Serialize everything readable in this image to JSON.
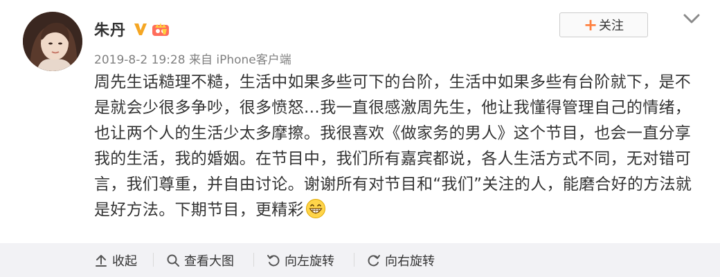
{
  "post": {
    "author": {
      "name": "朱丹",
      "verified_icon": "verified-v-icon",
      "member_icon": "crown-member-icon"
    },
    "meta": {
      "timestamp": "2019-8-2 19:28",
      "source": "来自 iPhone客户端"
    },
    "follow_button": {
      "plus": "+",
      "label": "关注"
    },
    "menu_icon": "chevron-down-icon",
    "content": {
      "text": "周先生话糙理不糙，生活中如果多些可下的台阶，生活中如果多些有台阶就下，是不是就会少很多争吵，很多愤怒…我一直很感激周先生，他让我懂得管理自己的情绪，也让两个人的生活少太多摩擦。我很喜欢《做家务的男人》这个节目，也会一直分享我的生活，我的婚姻。在节目中，我们所有嘉宾都说，各人生活方式不同，无对错可言，我们尊重，并自由讨论。谢谢所有对节目和“我们”关注的人，能磨合好的方法就是好方法。下期节目，更精彩",
      "emoji": "grin-emoji"
    }
  },
  "toolbar": {
    "collapse": {
      "label": "收起",
      "icon": "collapse-arrow-icon"
    },
    "view_large": {
      "label": "查看大图",
      "icon": "search-icon"
    },
    "rotate_left": {
      "label": "向左旋转",
      "icon": "rotate-left-icon"
    },
    "rotate_right": {
      "label": "向右旋转",
      "icon": "rotate-right-icon"
    }
  },
  "colors": {
    "accent_orange": "#ff8140",
    "verified_gold": "#f5a623",
    "text_primary": "#333333",
    "text_secondary": "#808080",
    "toolbar_bg": "#f2f2f5"
  }
}
